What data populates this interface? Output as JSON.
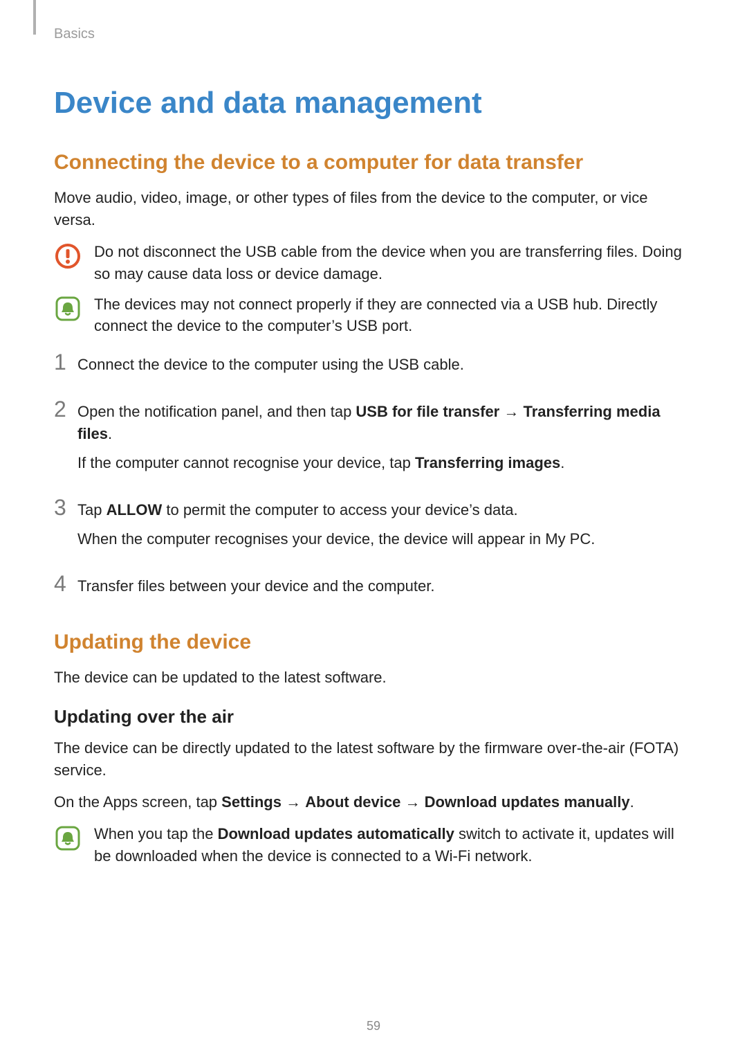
{
  "header": {
    "label": "Basics"
  },
  "title": "Device and data management",
  "section1": {
    "heading": "Connecting the device to a computer for data transfer",
    "intro": "Move audio, video, image, or other types of files from the device to the computer, or vice versa.",
    "warning": "Do not disconnect the USB cable from the device when you are transferring files. Doing so may cause data loss or device damage.",
    "note": "The devices may not connect properly if they are connected via a USB hub. Directly connect the device to the computer’s USB port.",
    "steps": {
      "n1": "1",
      "s1": "Connect the device to the computer using the USB cable.",
      "n2": "2",
      "s2_pre": "Open the notification panel, and then tap ",
      "s2_b1": "USB for file transfer",
      "s2_arrow": " → ",
      "s2_b2": "Transferring media files",
      "s2_post": ".",
      "s2_line2_pre": "If the computer cannot recognise your device, tap ",
      "s2_line2_b": "Transferring images",
      "s2_line2_post": ".",
      "n3": "3",
      "s3_pre": "Tap ",
      "s3_b": "ALLOW",
      "s3_post": " to permit the computer to access your device’s data.",
      "s3_line2": "When the computer recognises your device, the device will appear in My PC.",
      "n4": "4",
      "s4": "Transfer files between your device and the computer."
    }
  },
  "section2": {
    "heading": "Updating the device",
    "intro": "The device can be updated to the latest software.",
    "sub_heading": "Updating over the air",
    "ota_p1": "The device can be directly updated to the latest software by the firmware over-the-air (FOTA) service.",
    "ota_p2_pre": "On the Apps screen, tap ",
    "ota_p2_b1": "Settings",
    "ota_p2_a1": " → ",
    "ota_p2_b2": "About device",
    "ota_p2_a2": " → ",
    "ota_p2_b3": "Download updates manually",
    "ota_p2_post": ".",
    "note_pre": "When you tap the ",
    "note_b": "Download updates automatically",
    "note_post": " switch to activate it, updates will be downloaded when the device is connected to a Wi-Fi network."
  },
  "page_number": "59"
}
